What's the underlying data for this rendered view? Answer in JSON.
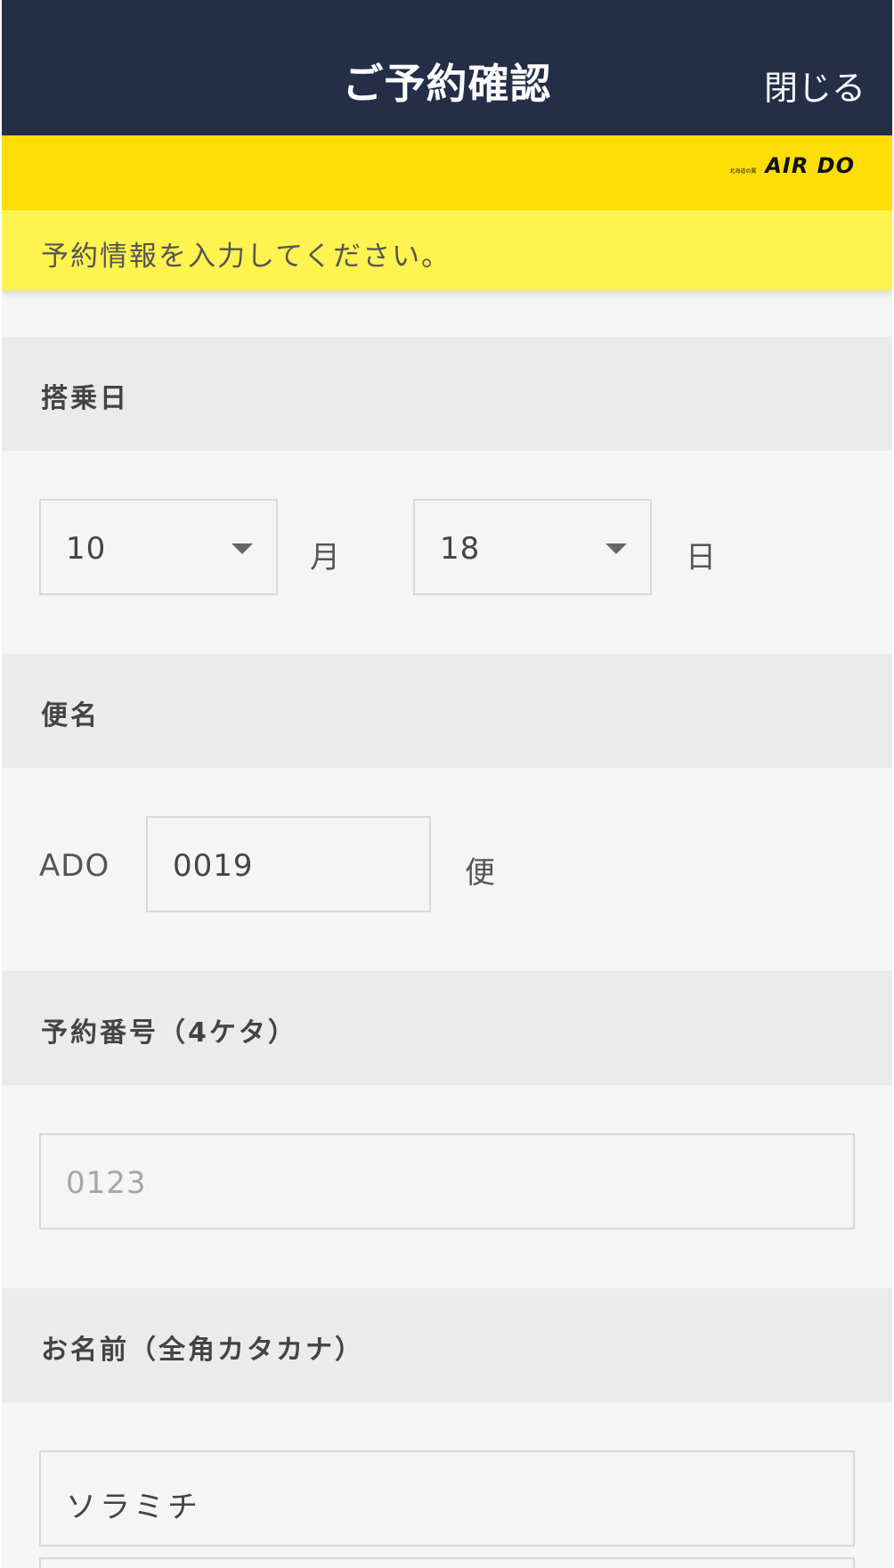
{
  "header": {
    "title": "ご予約確認",
    "close_label": "閉じる"
  },
  "brand": {
    "subtitle": "北海道の翼",
    "name": "AIR DO"
  },
  "notice": "予約情報を入力してください。",
  "boarding_date": {
    "label": "搭乗日",
    "month_value": "10",
    "month_unit": "月",
    "day_value": "18",
    "day_unit": "日"
  },
  "flight": {
    "label": "便名",
    "prefix": "ADO",
    "number_value": "0019",
    "unit": "便"
  },
  "reservation": {
    "label": "予約番号（4ケタ）",
    "placeholder": "0123"
  },
  "name": {
    "label": "お名前（全角カタカナ）",
    "value": "ソラミチ"
  },
  "colors": {
    "header_bg": "#242e47",
    "brand_bar": "#ffde07",
    "notice_bg": "#fff350"
  }
}
